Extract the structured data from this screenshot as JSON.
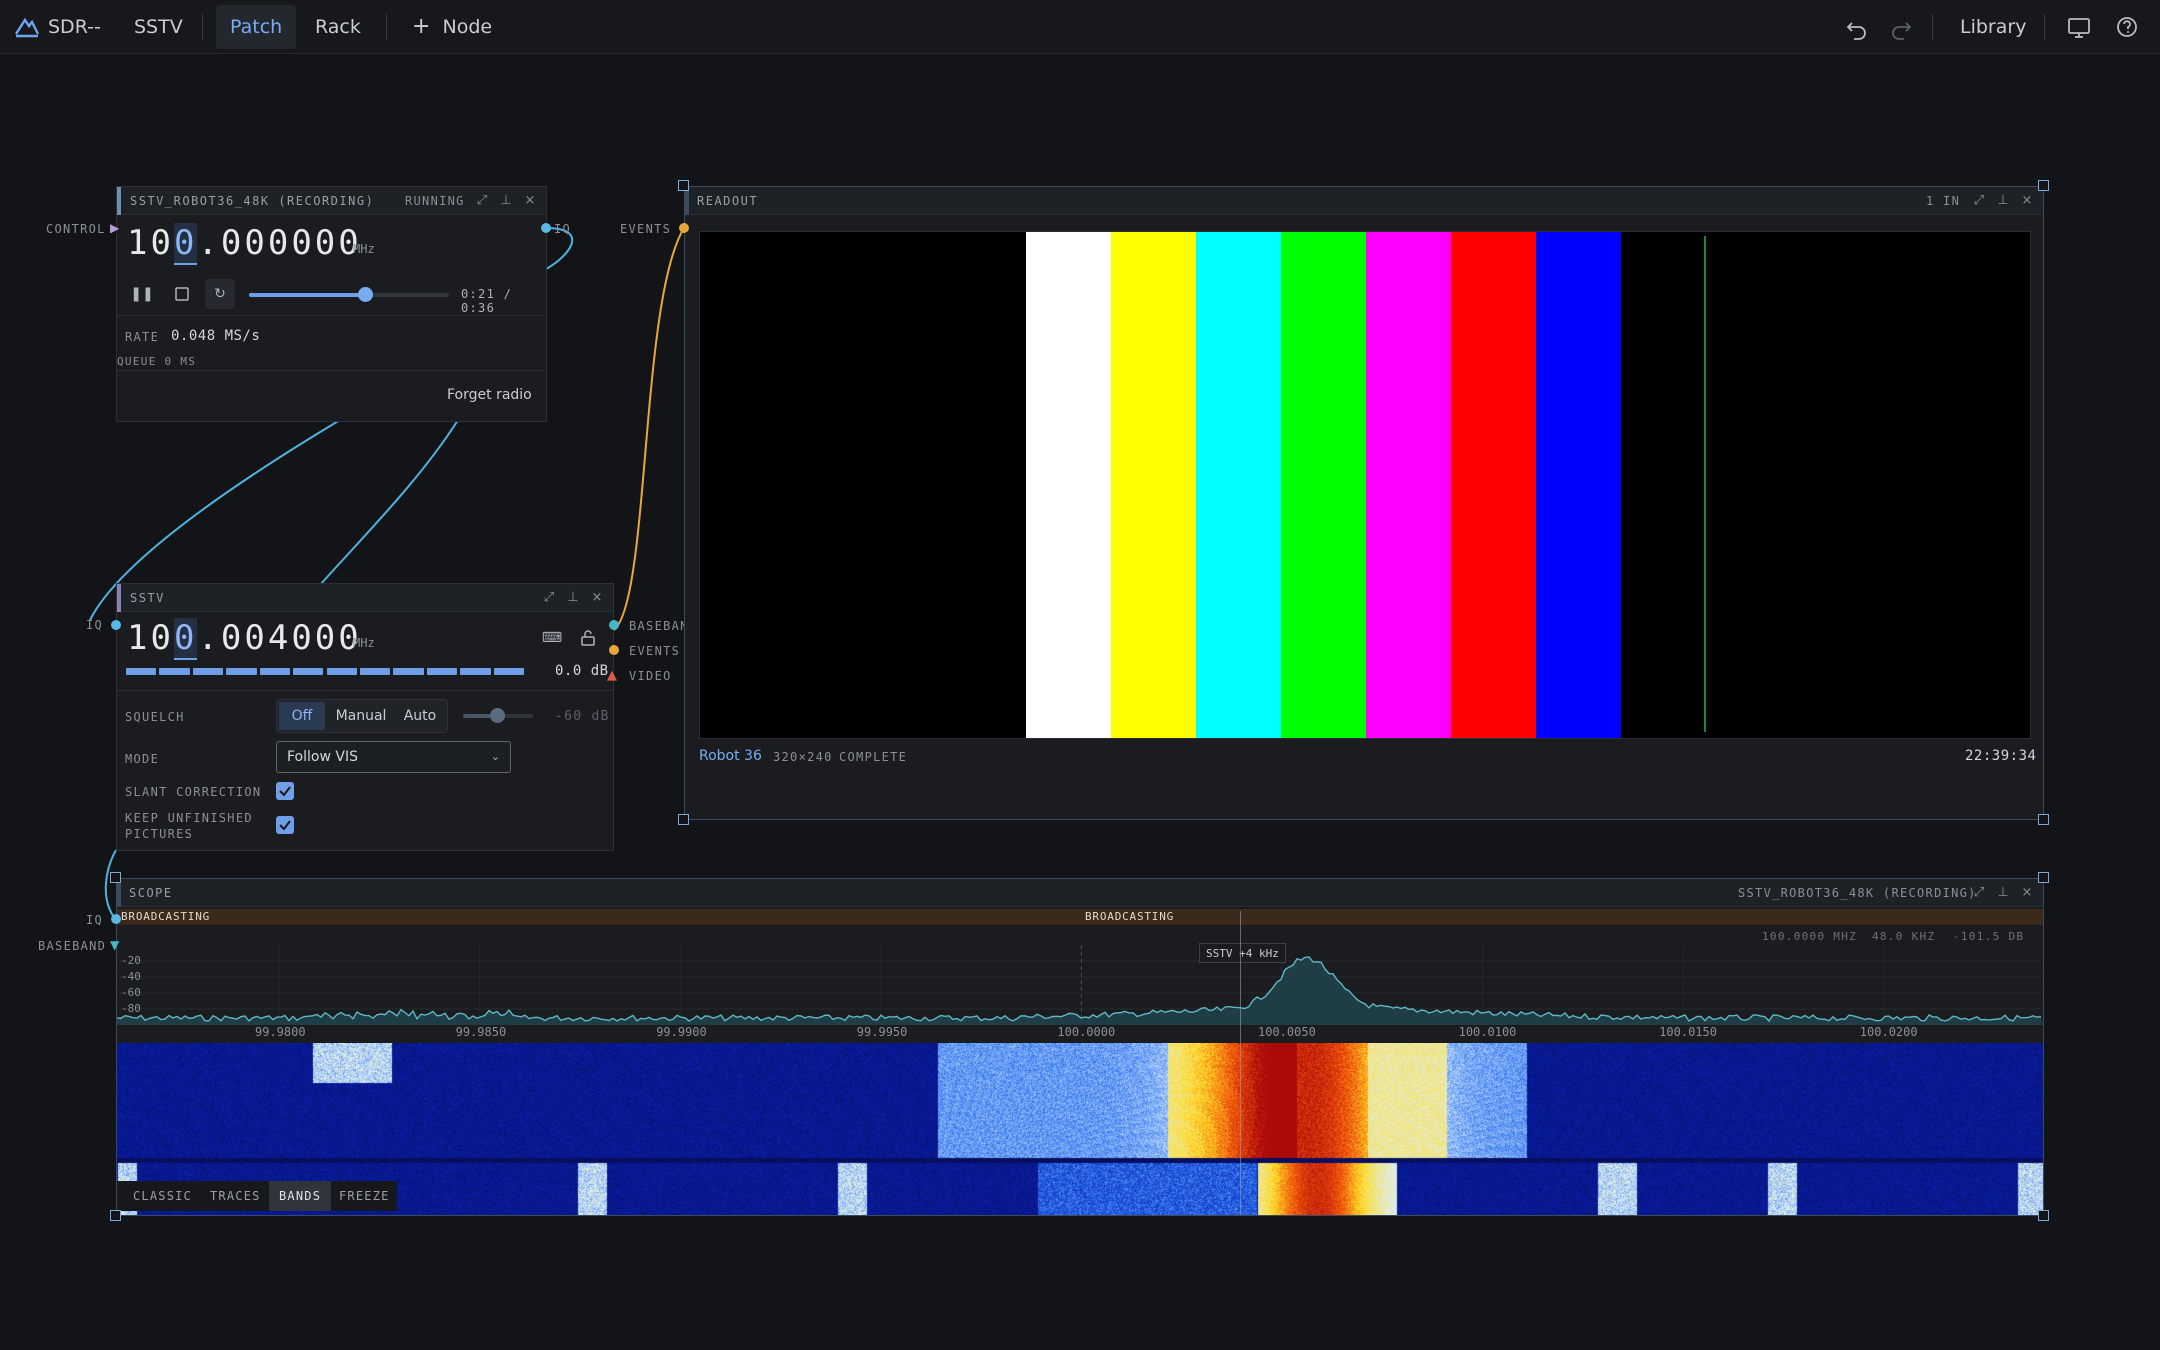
{
  "app": {
    "name": "SDR--",
    "project": "SSTV"
  },
  "tabs": [
    {
      "label": "Patch",
      "active": true
    },
    {
      "label": "Rack",
      "active": false
    }
  ],
  "add_node_label": "Node",
  "library_label": "Library",
  "radio": {
    "title": "SSTV_ROBOT36_48K (RECORDING)",
    "status": "RUNNING",
    "control_port": "CONTROL",
    "iq_port": "IQ",
    "freq_pre": "10",
    "freq_hl": "0",
    "freq_post": ".000000",
    "freq_unit": "MHz",
    "playback_position": 0.58,
    "time": "0:21 / 0:36",
    "rate_label": "RATE",
    "rate_value": "0.048 MS/s",
    "queue_label": "QUEUE 0 MS",
    "forget_label": "Forget radio"
  },
  "sstv": {
    "title": "SSTV",
    "iq_port": "IQ",
    "baseband_port": "BASEBAN",
    "events_port": "EVENTS",
    "video_port": "VIDEO",
    "freq_pre": "10",
    "freq_hl": "0",
    "freq_post": ".004000",
    "freq_unit": "MHz",
    "level_db": "0.0 dB",
    "squelch_label": "SQUELCH",
    "squelch_options": [
      "Off",
      "Manual",
      "Auto"
    ],
    "squelch_selected": "Off",
    "squelch_db": "-60 dB",
    "mode_label": "MODE",
    "mode_value": "Follow VIS",
    "slant_label": "SLANT CORRECTION",
    "slant_checked": true,
    "keep_label_1": "KEEP UNFINISHED",
    "keep_label_2": "PICTURES",
    "keep_checked": true
  },
  "readout": {
    "title": "READOUT",
    "inputs": "1 IN",
    "events_port": "EVENTS",
    "mode_name": "Robot 36",
    "resolution": "320×240",
    "state": "COMPLETE",
    "timestamp": "22:39:34",
    "bar_colors": [
      "#ffffff",
      "#ffff00",
      "#00ffff",
      "#00ff00",
      "#ff00ff",
      "#ff0000",
      "#0000ff",
      "#000000"
    ]
  },
  "scope": {
    "title": "SCOPE",
    "source": "SSTV_ROBOT36_48K (RECORDING)",
    "iq_port": "IQ",
    "baseband_port": "BASEBAND",
    "band_label_1": "BROADCASTING",
    "band_label_2": "BROADCASTING",
    "center_freq": "100.0000 MHZ",
    "span": "48.0 KHZ",
    "level": "-101.5 DB",
    "marker_label": "SSTV +4 kHz",
    "db_ticks": [
      "-20",
      "-40",
      "-60",
      "-80"
    ],
    "freq_ticks": [
      "99.9800",
      "99.9850",
      "99.9900",
      "99.9950",
      "100.0000",
      "100.0050",
      "100.0100",
      "100.0150",
      "100.0200"
    ],
    "view_modes": [
      "CLASSIC",
      "TRACES",
      "BANDS",
      "FREEZE"
    ],
    "view_selected": "BANDS"
  }
}
